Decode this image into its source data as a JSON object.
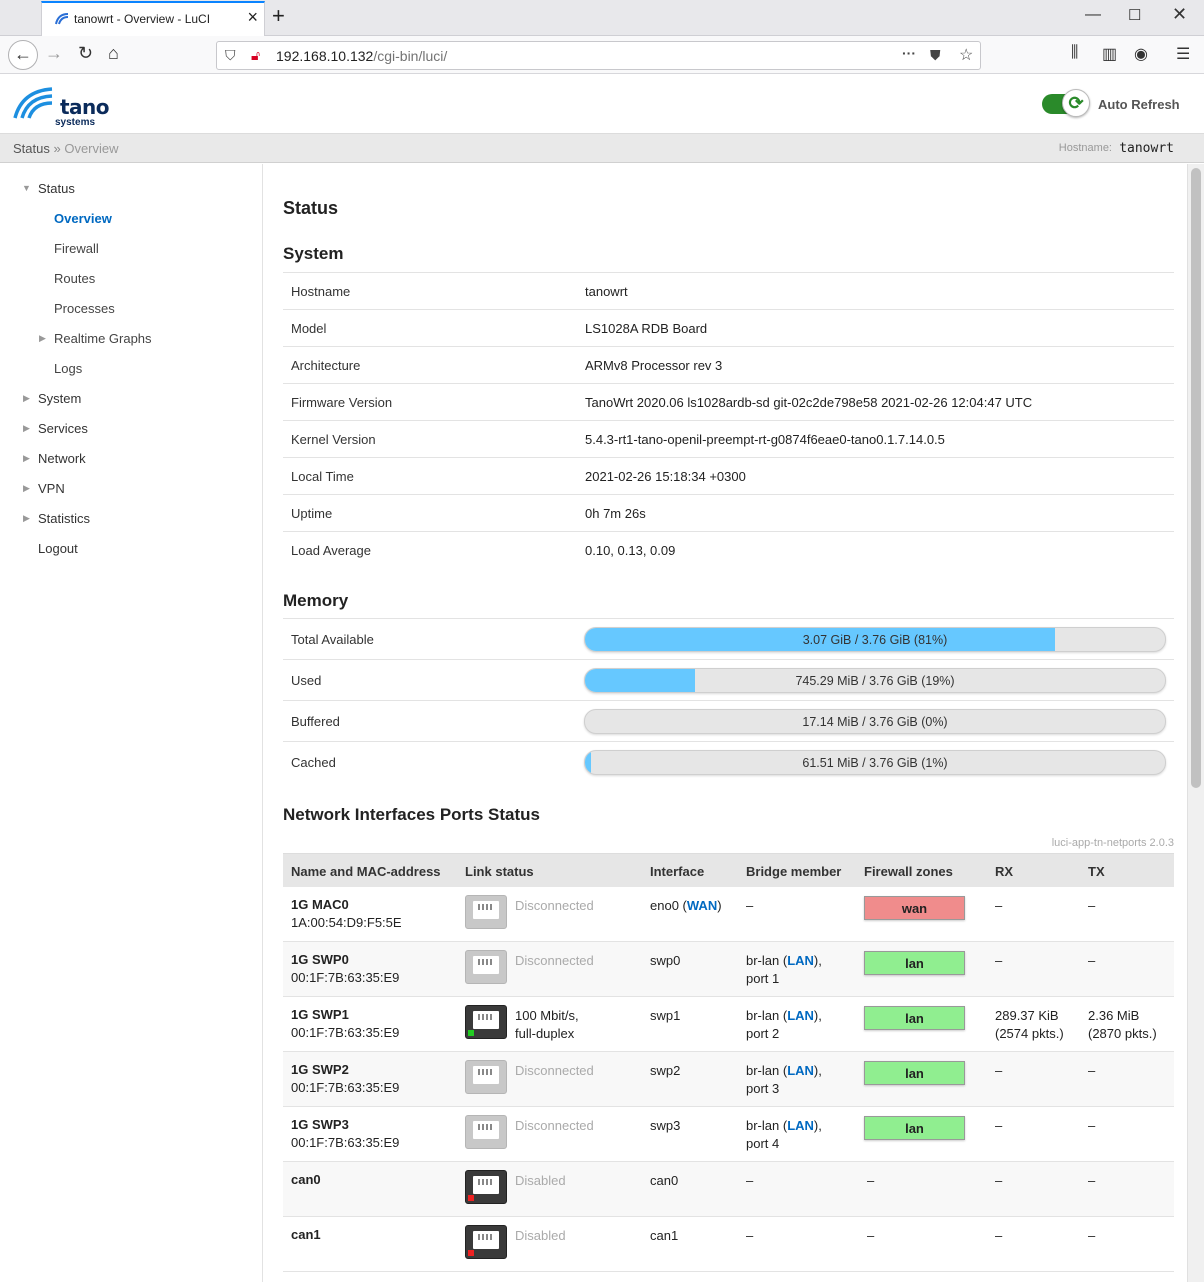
{
  "browser": {
    "tab_title": "tanowrt - Overview - LuCI",
    "url_host": "192.168.10.132",
    "url_path": "/cgi-bin/luci/"
  },
  "header": {
    "logo_word": "tano",
    "logo_sub": "systems",
    "auto_refresh_label": "Auto Refresh",
    "auto_refresh_on": true
  },
  "breadcrumb": {
    "root": "Status",
    "separator": "»",
    "current": "Overview",
    "hostname_label": "Hostname:",
    "hostname_value": "tanowrt"
  },
  "sidebar": {
    "items": [
      {
        "label": "Status",
        "expanded": true
      },
      {
        "label": "Overview"
      },
      {
        "label": "Firewall"
      },
      {
        "label": "Routes"
      },
      {
        "label": "Processes"
      },
      {
        "label": "Realtime Graphs"
      },
      {
        "label": "Logs"
      },
      {
        "label": "System"
      },
      {
        "label": "Services"
      },
      {
        "label": "Network"
      },
      {
        "label": "VPN"
      },
      {
        "label": "Statistics"
      },
      {
        "label": "Logout"
      }
    ]
  },
  "main": {
    "page_title": "Status",
    "system": {
      "title": "System",
      "rows": [
        {
          "key": "Hostname",
          "value": "tanowrt"
        },
        {
          "key": "Model",
          "value": "LS1028A RDB Board"
        },
        {
          "key": "Architecture",
          "value": "ARMv8 Processor rev 3"
        },
        {
          "key": "Firmware Version",
          "value": "TanoWrt 2020.06 ls1028ardb-sd git-02c2de798e58 2021-02-26 12:04:47 UTC"
        },
        {
          "key": "Kernel Version",
          "value": "5.4.3-rt1-tano-openil-preempt-rt-g0874f6eae0-tano0.1.7.14.0.5"
        },
        {
          "key": "Local Time",
          "value": "2021-02-26 15:18:34 +0300"
        },
        {
          "key": "Uptime",
          "value": "0h 7m 26s"
        },
        {
          "key": "Load Average",
          "value": "0.10, 0.13, 0.09"
        }
      ]
    },
    "memory": {
      "title": "Memory",
      "rows": [
        {
          "key": "Total Available",
          "text": "3.07 GiB / 3.76 GiB (81%)",
          "percent": 81
        },
        {
          "key": "Used",
          "text": "745.29 MiB / 3.76 GiB (19%)",
          "percent": 19
        },
        {
          "key": "Buffered",
          "text": "17.14 MiB / 3.76 GiB (0%)",
          "percent": 0
        },
        {
          "key": "Cached",
          "text": "61.51 MiB / 3.76 GiB (1%)",
          "percent": 1
        }
      ]
    },
    "ports": {
      "title": "Network Interfaces Ports Status",
      "version": "luci-app-tn-netports 2.0.3",
      "headers": [
        "Name and MAC-address",
        "Link status",
        "Interface",
        "Bridge member",
        "Firewall zones",
        "RX",
        "TX"
      ],
      "rows": [
        {
          "name": "1G MAC0",
          "mac": "1A:00:54:D9:F5:5E",
          "link": "Disconnected",
          "link2": "",
          "state": "off",
          "iface": "eno0 (",
          "iface_net": "WAN",
          "iface_end": ")",
          "bridge": "–",
          "bridge_net": "",
          "bridge_end": "",
          "bridge2": "",
          "zone": "wan",
          "zone_color": "#f08c8c",
          "rx": "–",
          "rx2": "",
          "tx": "–",
          "tx2": ""
        },
        {
          "name": "1G SWP0",
          "mac": "00:1F:7B:63:35:E9",
          "link": "Disconnected",
          "link2": "",
          "state": "off",
          "iface": "swp0",
          "iface_net": "",
          "iface_end": "",
          "bridge": "br-lan (",
          "bridge_net": "LAN",
          "bridge_end": "),",
          "bridge2": "port 1",
          "zone": "lan",
          "zone_color": "#90ee90",
          "rx": "–",
          "rx2": "",
          "tx": "–",
          "tx2": ""
        },
        {
          "name": "1G SWP1",
          "mac": "00:1F:7B:63:35:E9",
          "link": "100 Mbit/s,",
          "link2": "full-duplex",
          "state": "up",
          "iface": "swp1",
          "iface_net": "",
          "iface_end": "",
          "bridge": "br-lan (",
          "bridge_net": "LAN",
          "bridge_end": "),",
          "bridge2": "port 2",
          "zone": "lan",
          "zone_color": "#90ee90",
          "rx": "289.37 KiB",
          "rx2": "(2574 pkts.)",
          "tx": "2.36 MiB",
          "tx2": "(2870 pkts.)"
        },
        {
          "name": "1G SWP2",
          "mac": "00:1F:7B:63:35:E9",
          "link": "Disconnected",
          "link2": "",
          "state": "off",
          "iface": "swp2",
          "iface_net": "",
          "iface_end": "",
          "bridge": "br-lan (",
          "bridge_net": "LAN",
          "bridge_end": "),",
          "bridge2": "port 3",
          "zone": "lan",
          "zone_color": "#90ee90",
          "rx": "–",
          "rx2": "",
          "tx": "–",
          "tx2": ""
        },
        {
          "name": "1G SWP3",
          "mac": "00:1F:7B:63:35:E9",
          "link": "Disconnected",
          "link2": "",
          "state": "off",
          "iface": "swp3",
          "iface_net": "",
          "iface_end": "",
          "bridge": "br-lan (",
          "bridge_net": "LAN",
          "bridge_end": "),",
          "bridge2": "port 4",
          "zone": "lan",
          "zone_color": "#90ee90",
          "rx": "–",
          "rx2": "",
          "tx": "–",
          "tx2": ""
        },
        {
          "name": "can0",
          "mac": "",
          "link": "Disabled",
          "link2": "",
          "state": "disabled",
          "iface": "can0",
          "iface_net": "",
          "iface_end": "",
          "bridge": "–",
          "bridge_net": "",
          "bridge_end": "",
          "bridge2": "",
          "zone": "–",
          "zone_color": "",
          "rx": "–",
          "rx2": "",
          "tx": "–",
          "tx2": ""
        },
        {
          "name": "can1",
          "mac": "",
          "link": "Disabled",
          "link2": "",
          "state": "disabled",
          "iface": "can1",
          "iface_net": "",
          "iface_end": "",
          "bridge": "–",
          "bridge_net": "",
          "bridge_end": "",
          "bridge2": "",
          "zone": "–",
          "zone_color": "",
          "rx": "–",
          "rx2": "",
          "tx": "–",
          "tx2": ""
        }
      ]
    }
  },
  "colors": {
    "accent": "#0069c1",
    "memory_fill": "#66c8ff",
    "toggle_on": "#2a8a2a",
    "led_up": "#22cc22",
    "led_disabled": "#ee2222"
  },
  "icons": [
    "back-icon",
    "forward-icon",
    "reload-icon",
    "home-icon",
    "shield-icon",
    "insecure-lock-icon",
    "more-icon",
    "pocket-icon",
    "star-icon",
    "library-icon",
    "sidebar-icon",
    "account-icon",
    "hamburger-menu-icon",
    "refresh-icon",
    "ethernet-port-icon"
  ]
}
